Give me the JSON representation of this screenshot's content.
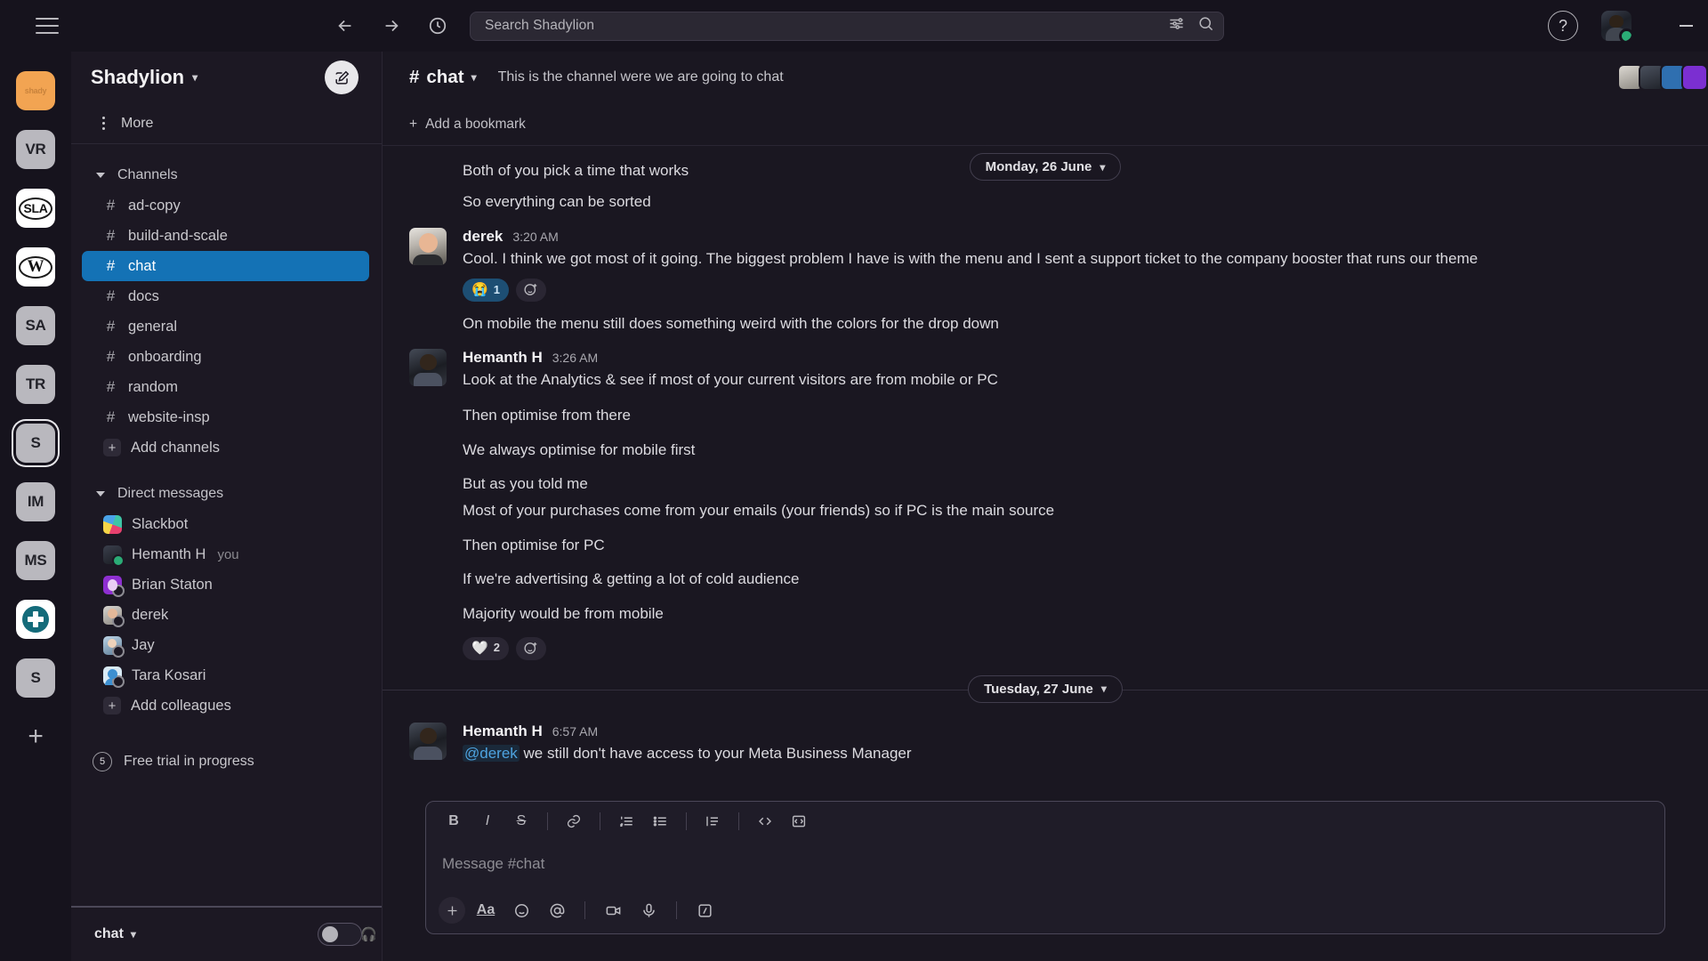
{
  "topbar": {
    "menu_icon": "hamburger-icon",
    "back_icon": "back-arrow-icon",
    "forward_icon": "forward-arrow-icon",
    "history_icon": "clock-history-icon",
    "search_placeholder": "Search Shadylion",
    "filter_icon": "filter-sliders-icon",
    "search_icon": "search-icon",
    "help_label": "?",
    "minimize_icon": "minimize-icon"
  },
  "rail": {
    "items": [
      {
        "label": "shady",
        "type": "orange"
      },
      {
        "label": "VR",
        "type": "grey"
      },
      {
        "label": "SLA",
        "type": "oval"
      },
      {
        "label": "W",
        "type": "oval-serif"
      },
      {
        "label": "SA",
        "type": "grey"
      },
      {
        "label": "TR",
        "type": "grey"
      },
      {
        "label": "S",
        "type": "grey",
        "selected": true
      },
      {
        "label": "IM",
        "type": "grey"
      },
      {
        "label": "MS",
        "type": "grey"
      },
      {
        "label": "+",
        "type": "medical"
      },
      {
        "label": "S",
        "type": "grey"
      },
      {
        "label": "+",
        "type": "add"
      }
    ]
  },
  "sidebar": {
    "workspace": "Shadylion",
    "compose_icon": "compose-pencil-icon",
    "more_label": "More",
    "sections": [
      {
        "name": "Channels",
        "items": [
          {
            "label": "ad-copy",
            "kind": "channel"
          },
          {
            "label": "build-and-scale",
            "kind": "channel"
          },
          {
            "label": "chat",
            "kind": "channel",
            "active": true
          },
          {
            "label": "docs",
            "kind": "channel"
          },
          {
            "label": "general",
            "kind": "channel"
          },
          {
            "label": "onboarding",
            "kind": "channel"
          },
          {
            "label": "random",
            "kind": "channel"
          },
          {
            "label": "website-insp",
            "kind": "channel"
          },
          {
            "label": "Add channels",
            "kind": "add"
          }
        ]
      },
      {
        "name": "Direct messages",
        "items": [
          {
            "label": "Slackbot",
            "kind": "dm",
            "avatar": "slackbot",
            "presence": "none"
          },
          {
            "label": "Hemanth H",
            "suffix": "you",
            "kind": "dm",
            "avatar": "hem",
            "presence": "online"
          },
          {
            "label": "Brian Staton",
            "kind": "dm",
            "avatar": "brian",
            "presence": "offline"
          },
          {
            "label": "derek",
            "kind": "dm",
            "avatar": "derek",
            "presence": "offline"
          },
          {
            "label": "Jay",
            "kind": "dm",
            "avatar": "jay",
            "presence": "offline"
          },
          {
            "label": "Tara Kosari",
            "kind": "dm",
            "avatar": "tara",
            "presence": "offline"
          },
          {
            "label": "Add colleagues",
            "kind": "add"
          }
        ]
      }
    ],
    "trial": {
      "count": "5",
      "label": "Free trial in progress"
    },
    "footer": {
      "label": "chat",
      "toggle_on": false,
      "headphones_icon": "headphones-icon"
    }
  },
  "channel": {
    "name": "chat",
    "hash": "#",
    "topic": "This is the channel were we are going to chat",
    "bookmark_label": "Add a bookmark"
  },
  "messages": {
    "date_dividers": [
      {
        "label": "Monday, 26 June"
      },
      {
        "label": "Tuesday, 27 June"
      }
    ],
    "items": [
      {
        "type": "cont",
        "text": "Both of you pick a time that works"
      },
      {
        "type": "cont",
        "text": "So everything can be sorted"
      },
      {
        "type": "msg",
        "author": "derek",
        "time": "3:20 AM",
        "avatar": "derek",
        "text": "Cool. I think we got most of it going. The biggest problem I have is with the menu and I sent a support ticket to the company booster that runs our theme",
        "reactions": [
          {
            "emoji": "😭",
            "count": "1",
            "highlight": true
          }
        ]
      },
      {
        "type": "cont",
        "text": "On mobile the menu still does something weird with the colors for the drop down"
      },
      {
        "type": "msg",
        "author": "Hemanth H",
        "time": "3:26 AM",
        "avatar": "hem",
        "text": "Look at the Analytics & see if most of your current visitors are from mobile or PC"
      },
      {
        "type": "cont",
        "text": "Then optimise from there"
      },
      {
        "type": "cont",
        "text": "We always optimise for mobile first"
      },
      {
        "type": "cont",
        "text": "But as you told me"
      },
      {
        "type": "cont",
        "text": "Most of your purchases come from your emails (your friends) so if PC is the main source"
      },
      {
        "type": "cont",
        "text": "Then optimise for PC"
      },
      {
        "type": "cont",
        "text": "If we're advertising & getting a lot of cold audience"
      },
      {
        "type": "cont",
        "text": "Majority would be from mobile",
        "reactions": [
          {
            "emoji": "🤍",
            "count": "2",
            "highlight": false
          }
        ]
      },
      {
        "type": "msg",
        "author": "Hemanth H",
        "time": "6:57 AM",
        "avatar": "hem",
        "mention": "@derek",
        "text": " we still don't have access to your Meta Business Manager"
      }
    ]
  },
  "composer": {
    "placeholder": "Message #chat",
    "format_buttons": [
      {
        "name": "bold-button",
        "glyph": "B"
      },
      {
        "name": "italic-button",
        "glyph": "I"
      },
      {
        "name": "strikethrough-button",
        "glyph": "S"
      },
      {
        "name": "link-button",
        "glyph": "link"
      },
      {
        "name": "ordered-list-button",
        "glyph": "ol"
      },
      {
        "name": "bulleted-list-button",
        "glyph": "ul"
      },
      {
        "name": "blockquote-button",
        "glyph": "quote"
      },
      {
        "name": "code-button",
        "glyph": "code"
      },
      {
        "name": "code-block-button",
        "glyph": "codeblock"
      }
    ],
    "action_buttons": [
      {
        "name": "attach-plus-button",
        "glyph": "plus"
      },
      {
        "name": "formatting-toggle-button",
        "glyph": "Aa"
      },
      {
        "name": "emoji-button",
        "glyph": "emoji"
      },
      {
        "name": "mention-button",
        "glyph": "at"
      },
      {
        "name": "video-clip-button",
        "glyph": "video"
      },
      {
        "name": "audio-clip-button",
        "glyph": "mic"
      },
      {
        "name": "slash-command-button",
        "glyph": "slash"
      }
    ]
  },
  "colors": {
    "accent": "#1472b5",
    "mention": "#4ea3e0",
    "online": "#2bac76",
    "sidebar_bg": "#1c1823",
    "main_bg": "#1a1721"
  }
}
